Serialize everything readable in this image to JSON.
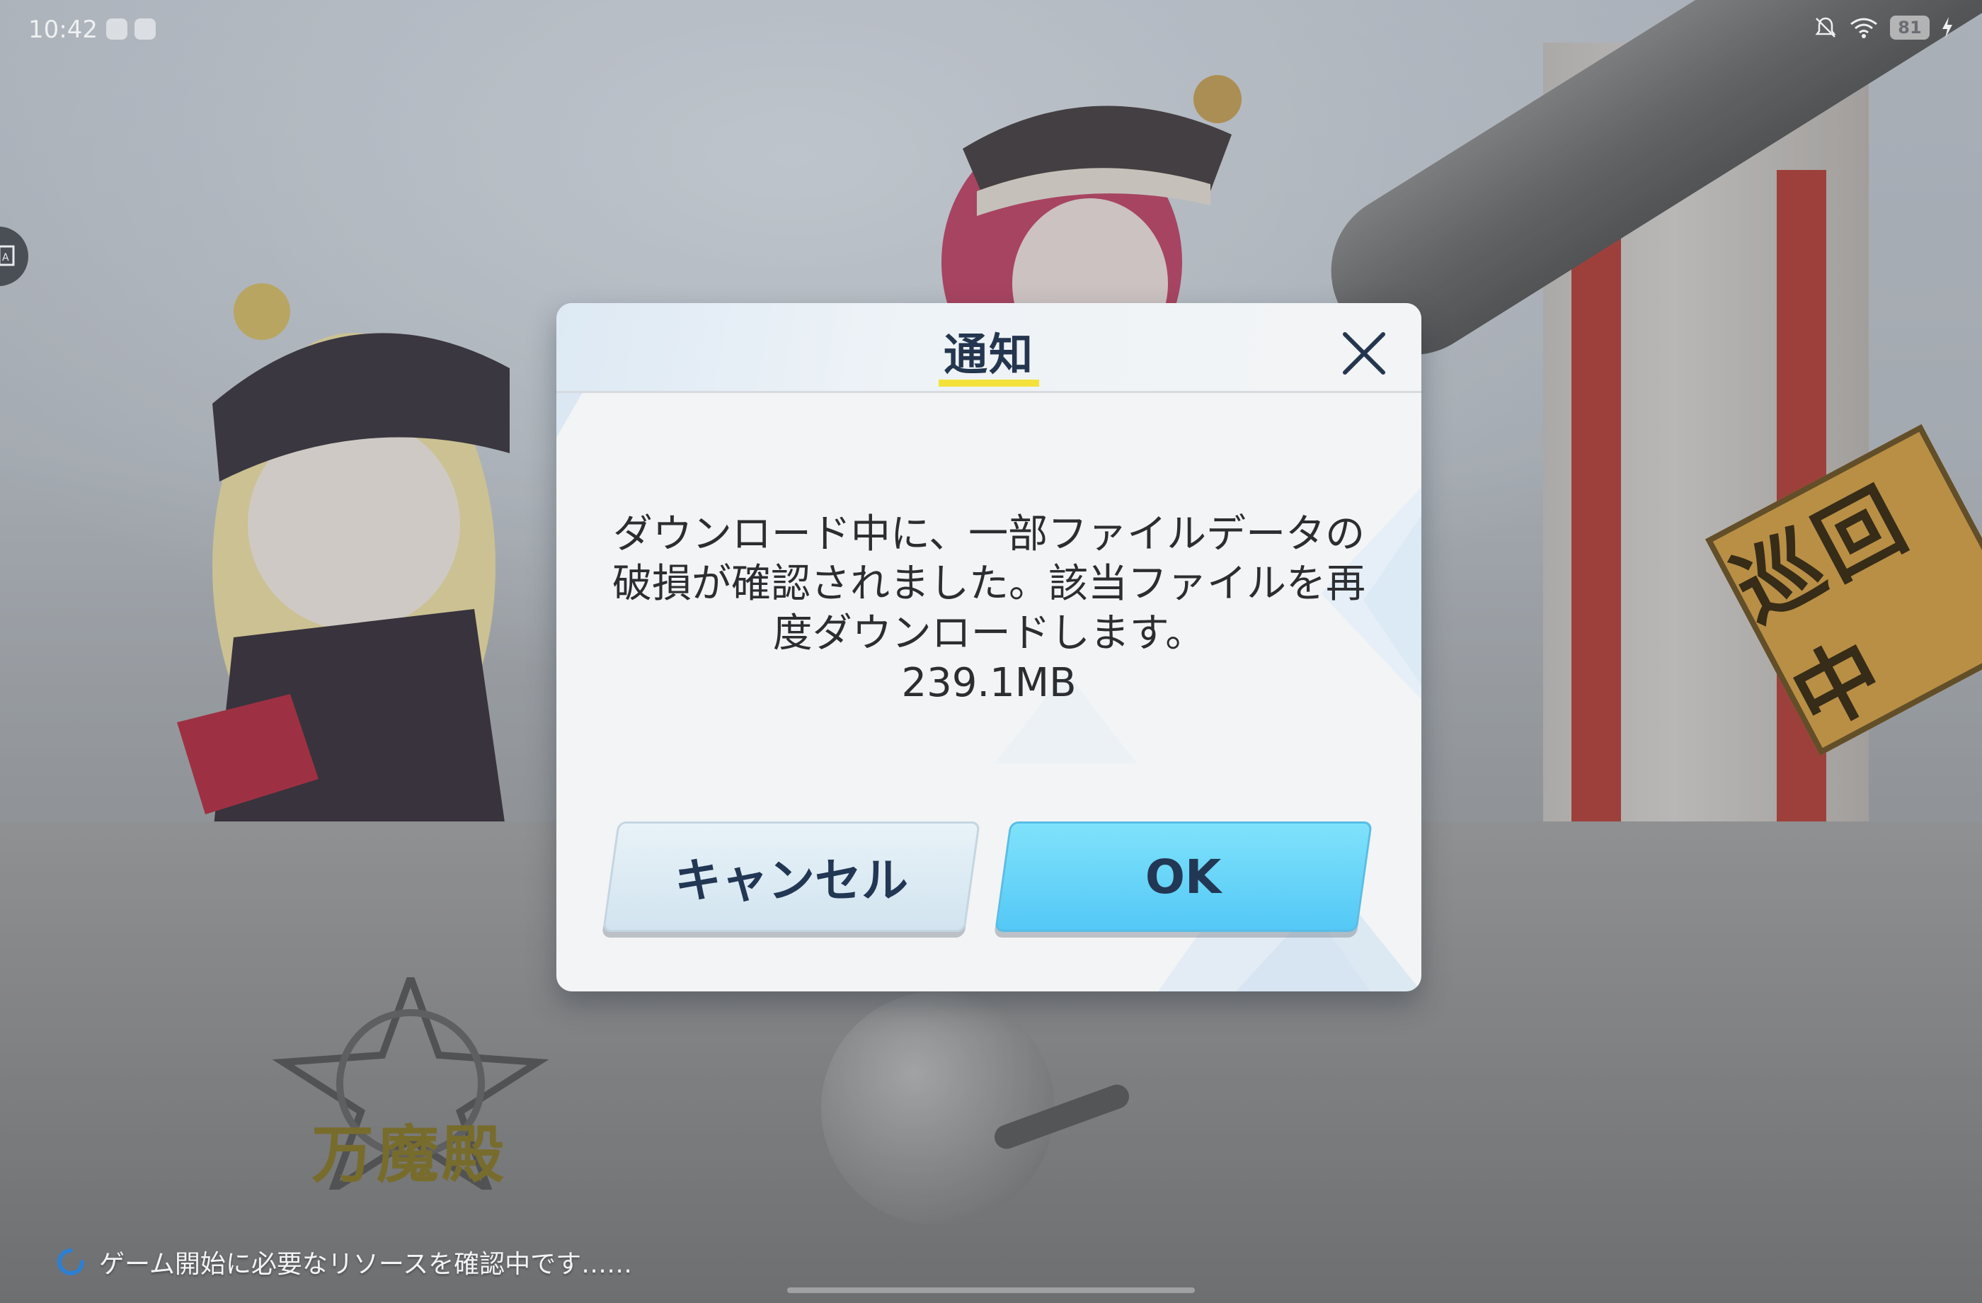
{
  "status_bar": {
    "time": "10:42",
    "battery": "81"
  },
  "background": {
    "sign_text": "巡回中",
    "emblem_text": "万魔殿"
  },
  "dialog": {
    "title": "通知",
    "message_lines": [
      "ダウンロード中に、一部ファイルデータの",
      "破損が確認されました。該当ファイルを再",
      "度ダウンロードします。",
      "239.1MB"
    ],
    "cancel_label": "キャンセル",
    "ok_label": "OK",
    "close_icon": "close-icon"
  },
  "loading": {
    "text": "ゲーム開始に必要なリソースを確認中です……"
  },
  "colors": {
    "title_text": "#24364f",
    "title_underline": "#f4e23c",
    "ok_button": "#54c8f6",
    "cancel_button": "#d2e4ef"
  }
}
